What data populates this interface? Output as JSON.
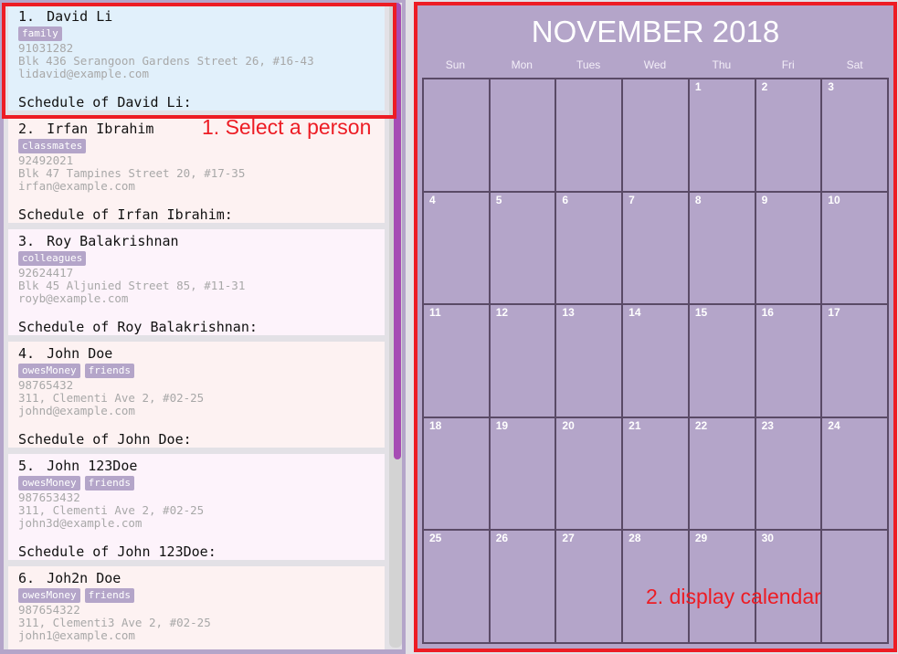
{
  "persons": [
    {
      "index": "1.",
      "name": "David Li",
      "tags": [
        "family"
      ],
      "phone": "91031282",
      "address": "Blk 436 Serangoon Gardens Street 26, #16-43",
      "email": "lidavid@example.com",
      "schedule": "Schedule of David Li:",
      "selected": true,
      "bg": "#e1f0fb"
    },
    {
      "index": "2.",
      "name": "Irfan Ibrahim",
      "tags": [
        "classmates"
      ],
      "phone": "92492021",
      "address": "Blk 47 Tampines Street 20, #17-35",
      "email": "irfan@example.com",
      "schedule": "Schedule of Irfan Ibrahim:",
      "bg": "#fdf2f2"
    },
    {
      "index": "3.",
      "name": "Roy Balakrishnan",
      "tags": [
        "colleagues"
      ],
      "phone": "92624417",
      "address": "Blk 45 Aljunied Street 85, #11-31",
      "email": "royb@example.com",
      "schedule": "Schedule of Roy Balakrishnan:",
      "bg": "#fdf3fb"
    },
    {
      "index": "4.",
      "name": "John Doe",
      "tags": [
        "owesMoney",
        "friends"
      ],
      "phone": "98765432",
      "address": "311, Clementi Ave 2, #02-25",
      "email": "johnd@example.com",
      "schedule": "Schedule of John Doe:",
      "bg": "#fdf2f2"
    },
    {
      "index": "5.",
      "name": "John 123Doe",
      "tags": [
        "owesMoney",
        "friends"
      ],
      "phone": "987653432",
      "address": "311, Clementi Ave 2, #02-25",
      "email": "john3d@example.com",
      "schedule": "Schedule of John 123Doe:",
      "bg": "#fdf3fb"
    },
    {
      "index": "6.",
      "name": "Joh2n Doe",
      "tags": [
        "owesMoney",
        "friends"
      ],
      "phone": "987654322",
      "address": "311, Clementi3 Ave 2, #02-25",
      "email": "john1@example.com",
      "schedule": "",
      "bg": "#fdf2f2"
    }
  ],
  "annotations": {
    "select": "1. Select a person",
    "calendar": "2. display calendar"
  },
  "calendar": {
    "title": "NOVEMBER 2018",
    "weekdays": [
      "Sun",
      "Mon",
      "Tues",
      "Wed",
      "Thu",
      "Fri",
      "Sat"
    ],
    "cells": [
      "",
      "",
      "",
      "",
      "1",
      "2",
      "3",
      "4",
      "5",
      "6",
      "7",
      "8",
      "9",
      "10",
      "11",
      "12",
      "13",
      "14",
      "15",
      "16",
      "17",
      "18",
      "19",
      "20",
      "21",
      "22",
      "23",
      "24",
      "25",
      "26",
      "27",
      "28",
      "29",
      "30",
      ""
    ]
  },
  "colors": {
    "accent": "#b4a5c9",
    "scroll_thumb": "#a64cb4",
    "highlight": "#ed1c24"
  }
}
